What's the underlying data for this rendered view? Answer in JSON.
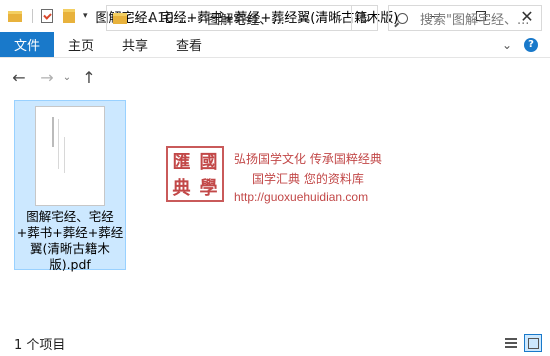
{
  "window": {
    "title": "图解宅经、宅经+葬书+葬经+葬经翼(清晰古籍木版)",
    "controls": {
      "minimize": "—",
      "maximize": "☐",
      "close": "✕"
    },
    "qa_dropdown": "▾"
  },
  "ribbon": {
    "tabs": [
      "文件",
      "主页",
      "共享",
      "查看"
    ],
    "expand": "⌄",
    "help": "?"
  },
  "nav": {
    "back": "←",
    "forward": "→",
    "recent": "⌄",
    "up": "↑",
    "address_prefix": "«",
    "crumbs": [
      "A10-...",
      "图解宅经、..."
    ],
    "separator": "›",
    "address_dropdown": "⌄",
    "refresh": "↻",
    "search_placeholder": "搜索\"图解宅经、..."
  },
  "files": [
    {
      "name": "图解宅经、宅经+葬书+葬经+葬经翼(清晰古籍木版).pdf",
      "selected": true
    }
  ],
  "watermark": {
    "seal_chars": [
      "匯",
      "國",
      "典",
      "學"
    ],
    "line1": "弘扬国学文化  传承国粹经典",
    "line2": "国学汇典  您的资料库",
    "url": "http://guoxuehuidian.com"
  },
  "status": {
    "item_count": "1 个项目"
  },
  "icons": {
    "quick_access": [
      "folder-icon",
      "properties-icon",
      "new-folder-icon"
    ],
    "views": [
      "details-view-icon",
      "large-icons-view-icon"
    ]
  },
  "colors": {
    "accent": "#1979ca",
    "selection": "#cce8ff",
    "watermark": "#c24848"
  }
}
